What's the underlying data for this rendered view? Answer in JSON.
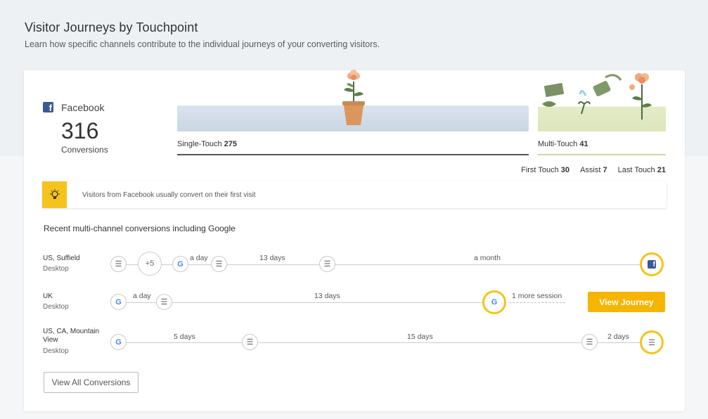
{
  "header": {
    "title": "Visitor Journeys by Touchpoint",
    "subtitle": "Learn how specific channels contribute to the individual journeys of your converting visitors."
  },
  "channel": {
    "name": "Facebook",
    "conversions": "316",
    "conversions_label": "Conversions"
  },
  "touch": {
    "single_label": "Single-Touch",
    "single_value": "275",
    "multi_label": "Multi-Touch",
    "multi_value": "41",
    "first_label": "First Touch",
    "first_value": "30",
    "assist_label": "Assist",
    "assist_value": "7",
    "last_label": "Last Touch",
    "last_value": "21"
  },
  "tip": {
    "text": "Visitors from Facebook usually convert on their first visit"
  },
  "section_title": "Recent multi-channel conversions including Google",
  "journeys": [
    {
      "location": "US, Suffield",
      "device": "Desktop",
      "more_badge": "+5",
      "gaps": [
        "a day",
        "13 days",
        "a month"
      ]
    },
    {
      "location": "UK",
      "device": "Desktop",
      "gaps": [
        "a day",
        "13 days"
      ],
      "extra": "1 more session"
    },
    {
      "location": "US, CA, Mountain View",
      "device": "Desktop",
      "gaps": [
        "5 days",
        "15 days",
        "2 days"
      ]
    }
  ],
  "icons": {
    "google": "G",
    "facebook": "f",
    "session": "session-icon",
    "bulb": "lightbulb-icon"
  },
  "buttons": {
    "view_journey": "View Journey",
    "view_all": "View All Conversions"
  },
  "colors": {
    "accent": "#f6c21c",
    "button": "#f6b500",
    "facebook": "#3b5998",
    "google_blue": "#4285f4"
  }
}
